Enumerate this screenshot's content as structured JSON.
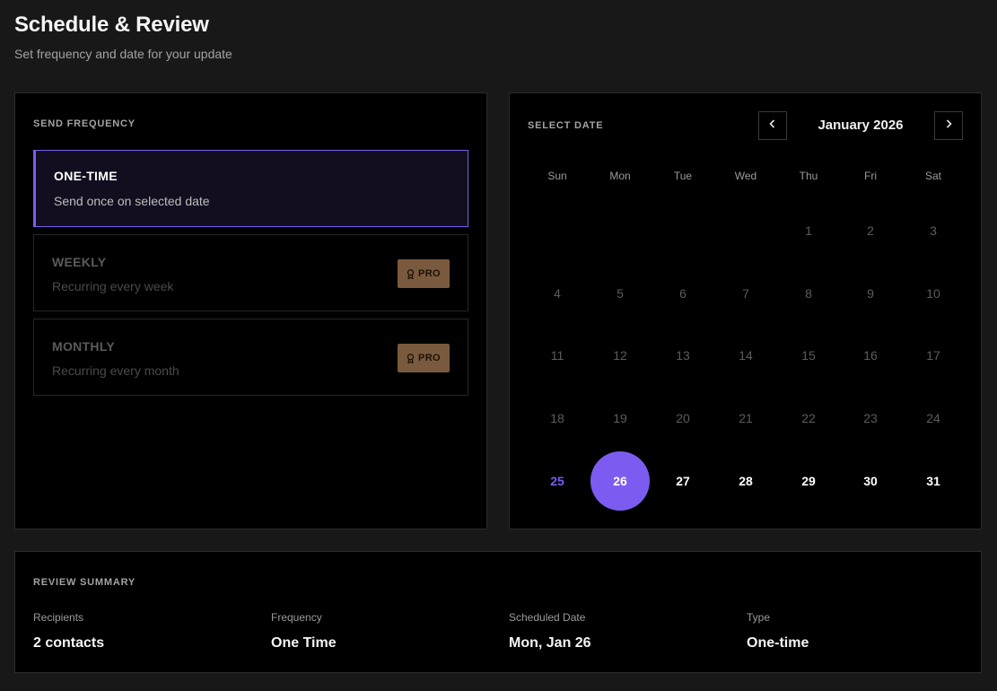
{
  "header": {
    "title": "Schedule & Review",
    "subtitle": "Set frequency and date for your update"
  },
  "frequency": {
    "label": "SEND FREQUENCY",
    "options": [
      {
        "title": "ONE-TIME",
        "description": "Send once on selected date",
        "state": "selected"
      },
      {
        "title": "WEEKLY",
        "description": "Recurring every week",
        "state": "disabled",
        "badge": "PRO"
      },
      {
        "title": "MONTHLY",
        "description": "Recurring every month",
        "state": "disabled",
        "badge": "PRO"
      }
    ]
  },
  "calendar": {
    "label": "SELECT DATE",
    "month": "January 2026",
    "weekdays": [
      "Sun",
      "Mon",
      "Tue",
      "Wed",
      "Thu",
      "Fri",
      "Sat"
    ],
    "weeks": [
      [
        "",
        "",
        "",
        "",
        "1",
        "2",
        "3"
      ],
      [
        "4",
        "5",
        "6",
        "7",
        "8",
        "9",
        "10"
      ],
      [
        "11",
        "12",
        "13",
        "14",
        "15",
        "16",
        "17"
      ],
      [
        "18",
        "19",
        "20",
        "21",
        "22",
        "23",
        "24"
      ],
      [
        "25",
        "26",
        "27",
        "28",
        "29",
        "30",
        "31"
      ]
    ],
    "today": "25",
    "selected": "26",
    "accent_color": "#7c5cf0"
  },
  "review": {
    "label": "REVIEW SUMMARY",
    "items": [
      {
        "label": "Recipients",
        "value": "2 contacts"
      },
      {
        "label": "Frequency",
        "value": "One Time"
      },
      {
        "label": "Scheduled Date",
        "value": "Mon, Jan 26"
      },
      {
        "label": "Type",
        "value": "One-time"
      }
    ]
  }
}
